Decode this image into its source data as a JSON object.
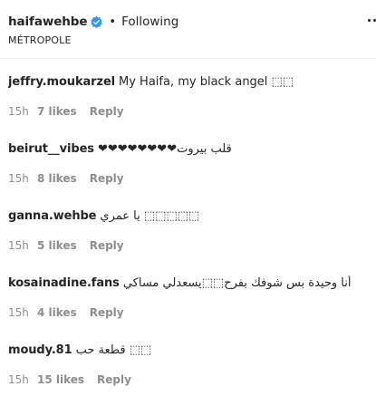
{
  "header": {
    "username": "haifawehbe",
    "separator": "•",
    "follow_status": "Following",
    "location": "MÉTROPOLE"
  },
  "comments": [
    {
      "user": "jeffry.moukarzel",
      "text": "My Haifa, my black angel ⬚⬚",
      "time": "15h",
      "likes": "7 likes",
      "reply": "Reply"
    },
    {
      "user": "beirut__vibes",
      "text": "❤❤❤❤❤❤❤❤قلب بيروت",
      "time": "15h",
      "likes": "8 likes",
      "reply": "Reply"
    },
    {
      "user": "ganna.wehbe",
      "text": "يا عمري ⬚⬚⬚⬚⬚",
      "time": "15h",
      "likes": "5 likes",
      "reply": "Reply"
    },
    {
      "user": "kosainadine.fans",
      "text": "أنا وحيدة بس شوفك بفرح⬚⬚يسعدلي مساكي",
      "time": "15h",
      "likes": "4 likes",
      "reply": "Reply"
    },
    {
      "user": "moudy.81",
      "text": "قطعة حب ⬚⬚",
      "time": "15h",
      "likes": "15 likes",
      "reply": "Reply"
    }
  ],
  "colors": {
    "verified": "#3897f0",
    "text": "#262626",
    "meta": "#8e8e8e",
    "divider": "#efefef"
  },
  "icons": {
    "verified": "verified-badge-icon",
    "more": "more-options-icon"
  }
}
